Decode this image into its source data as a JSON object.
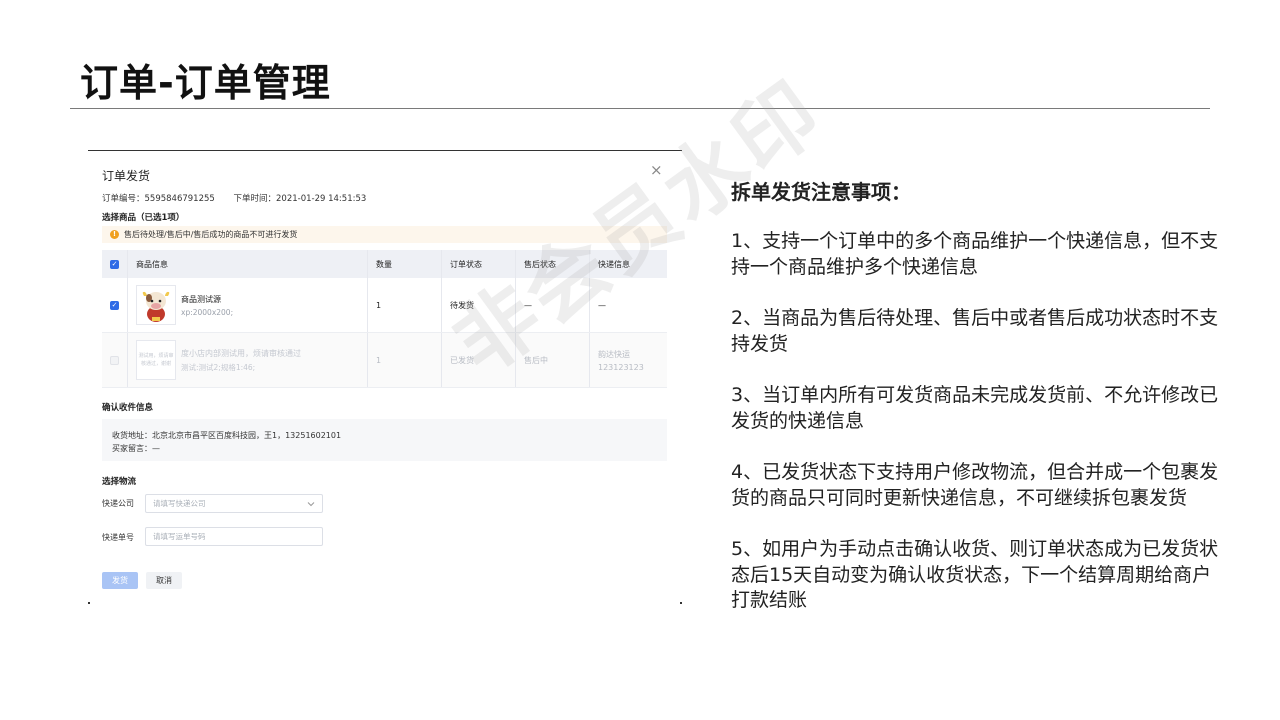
{
  "slide": {
    "title": "订单-订单管理"
  },
  "dialog": {
    "title": "订单发货",
    "close_icon": "×",
    "order_no": "订单编号：5595846791255",
    "order_time": "下单时间：2021-01-29 14:51:53",
    "select_label": "选择商品（已选1项）",
    "warning": "售后待处理/售后中/售后成功的商品不可进行发货",
    "warning_icon": "!",
    "table": {
      "headers": [
        "商品信息",
        "数量",
        "订单状态",
        "售后状态",
        "快递信息"
      ],
      "rows": [
        {
          "checked": true,
          "name": "商品测试源",
          "spec": "xp:2000x200;",
          "qty": "1",
          "order_status": "待发货",
          "after_status": "—",
          "express": "—",
          "express_no": ""
        },
        {
          "checked": false,
          "name": "度小店内部测试用，烦请审核通过",
          "spec": "测试:测试2;规格1:46;",
          "thumb_text": "测试用，烦请审 核通过，谢谢",
          "qty": "1",
          "order_status": "已发货",
          "after_status": "售后中",
          "express": "韵达快运",
          "express_no": "123123123"
        }
      ]
    },
    "receiver": {
      "section_label": "确认收件信息",
      "address": "收货地址：北京北京市昌平区百度科技园，王1，13251602101",
      "message": "买家留言：—"
    },
    "logistics": {
      "section_label": "选择物流",
      "company_label": "快递公司",
      "company_placeholder": "请填写快递公司",
      "tracking_label": "快递单号",
      "tracking_placeholder": "请填写运单号码"
    },
    "buttons": {
      "confirm": "发货",
      "cancel": "取消"
    }
  },
  "watermark": "非会员水印",
  "notes": {
    "heading": "拆单发货注意事项：",
    "items": [
      "1、支持一个订单中的多个商品维护一个快递信息，但不支持一个商品维护多个快递信息",
      "2、当商品为售后待处理、售后中或者售后成功状态时不支持发货",
      "3、当订单内所有可发货商品未完成发货前、不允许修改已发货的快递信息",
      "4、已发货状态下支持用户修改物流，但合并成一个包裹发货的商品只可同时更新快递信息，不可继续拆包裹发货",
      "5、如用户为手动点击确认收货、则订单状态成为已发货状态后15天自动变为确认收货状态，下一个结算周期给商户打款结账"
    ]
  },
  "colors": {
    "primary": "#2f6be6",
    "warning": "#f0a020",
    "confirm_disabled": "#a9c4f5"
  }
}
